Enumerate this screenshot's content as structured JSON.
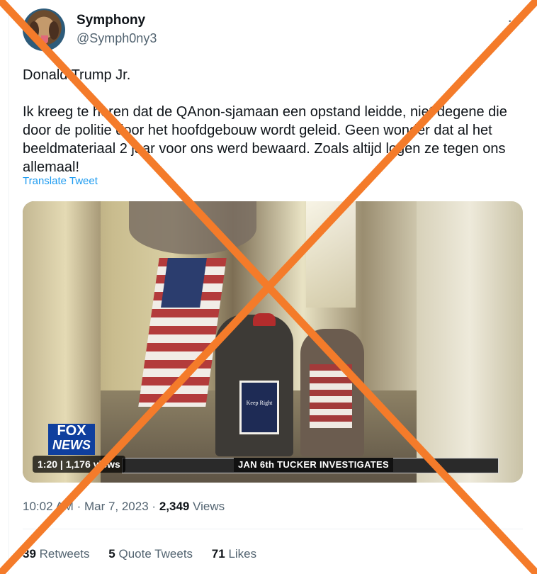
{
  "author": {
    "name": "Symphony",
    "handle": "@Symph0ny3"
  },
  "tweet": {
    "line1": "Donald Trump Jr.",
    "body": "Ik kreeg te horen dat de QAnon-sjamaan een opstand leidde, niet degene die door de politie door het hoofdgebouw wordt geleid. Geen wonder dat al het beeldmateriaal 2 jaar voor ons werd bewaard. Zoals altijd logen ze tegen ons allemaal!",
    "translate_label": "Translate Tweet"
  },
  "video": {
    "badge": "1:20 | 1,176 views",
    "chyron": "JAN 6th TUCKER INVESTIGATES",
    "logo_top": "FOX",
    "logo_bottom": "NEWS",
    "sign_text": "Keep Right"
  },
  "meta": {
    "time": "10:02 AM",
    "date": "Mar 7, 2023",
    "views_count": "2,349",
    "views_label": "Views"
  },
  "stats": {
    "retweets_count": "39",
    "retweets_label": "Retweets",
    "quotes_count": "5",
    "quotes_label": "Quote Tweets",
    "likes_count": "71",
    "likes_label": "Likes"
  },
  "colors": {
    "cross": "#f47b2a",
    "link": "#1d9bf0",
    "secondary_text": "#536471"
  },
  "icons": {
    "more": "more-icon"
  }
}
